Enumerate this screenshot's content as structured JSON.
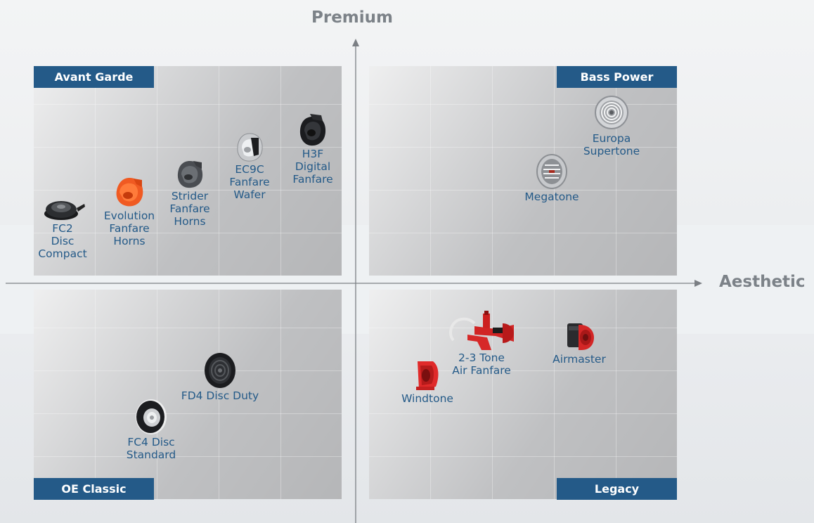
{
  "axes": {
    "vertical_label": "Premium",
    "horizontal_label": "Aesthetic"
  },
  "quadrants": {
    "top_left": "Avant Garde",
    "top_right": "Bass Power",
    "bottom_left": "OE Classic",
    "bottom_right": "Legacy"
  },
  "products": {
    "fc2": "FC2\nDisc\nCompact",
    "evolution": "Evolution\nFanfare\nHorns",
    "strider": "Strider\nFanfare\nHorns",
    "ec9c": "EC9C\nFanfare\nWafer",
    "h3f": "H3F\nDigital\nFanfare",
    "europa": "Europa\nSupertone",
    "megatone": "Megatone",
    "fd4": "FD4 Disc Duty",
    "fc4": "FC4 Disc\nStandard",
    "tone23": "2-3 Tone\nAir Fanfare",
    "airmaster": "Airmaster",
    "windtone": "Windtone"
  },
  "colors": {
    "badge": "#245a88",
    "label": "#245a88",
    "axis_title": "#7c8288",
    "axis_line": "#7b7f84"
  },
  "icons": {
    "fc2": "disc-horn-icon",
    "evolution": "orange-snail-horn-icon",
    "strider": "gray-snail-horn-icon",
    "ec9c": "chrome-wafer-horn-icon",
    "h3f": "black-snail-horn-icon",
    "europa": "chrome-grille-horn-icon",
    "megatone": "chrome-grille-horn-icon",
    "fd4": "black-disc-horn-icon",
    "fc4": "black-disc-horn-icon",
    "tone23": "red-air-trumpets-icon",
    "airmaster": "red-compressor-horn-icon",
    "windtone": "red-trumpet-horn-icon"
  }
}
